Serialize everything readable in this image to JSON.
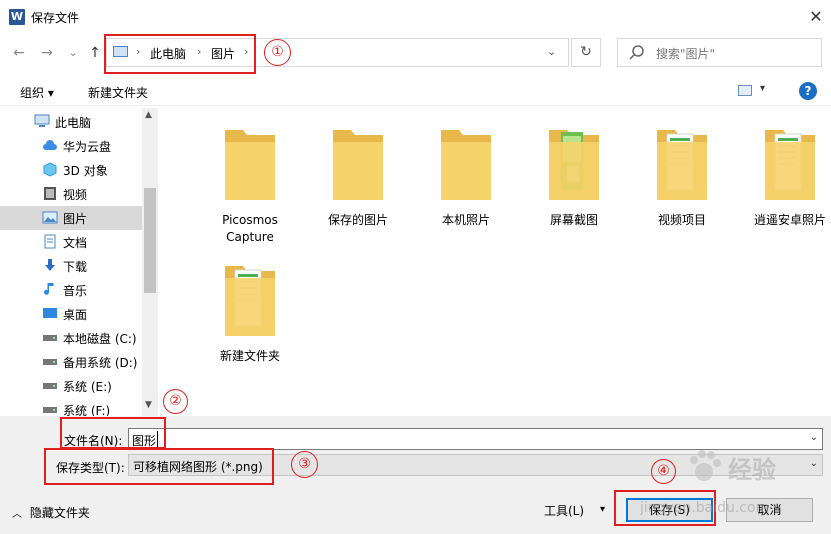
{
  "window": {
    "title": "保存文件",
    "app_icon": "W",
    "close": "✕"
  },
  "nav": {
    "back": "←",
    "forward": "→",
    "recent": "⌄",
    "up": "↑",
    "breadcrumbs": [
      "此电脑",
      "图片"
    ],
    "crumb_sep": "›",
    "search_placeholder": "搜索\"图片\""
  },
  "toolbar": {
    "organize": "组织 ▾",
    "new_folder": "新建文件夹",
    "view_drop": "▾",
    "help": "?"
  },
  "sidebar": {
    "items": [
      {
        "label": "此电脑",
        "icon": "computer-icon"
      },
      {
        "label": "华为云盘",
        "icon": "cloud-icon"
      },
      {
        "label": "3D 对象",
        "icon": "3d-objects-icon"
      },
      {
        "label": "视频",
        "icon": "video-icon"
      },
      {
        "label": "图片",
        "icon": "pictures-icon",
        "selected": true
      },
      {
        "label": "文档",
        "icon": "documents-icon"
      },
      {
        "label": "下载",
        "icon": "download-icon"
      },
      {
        "label": "音乐",
        "icon": "music-icon"
      },
      {
        "label": "桌面",
        "icon": "desktop-icon"
      },
      {
        "label": "本地磁盘 (C:)",
        "icon": "drive-icon"
      },
      {
        "label": "备用系统 (D:)",
        "icon": "drive-icon"
      },
      {
        "label": "系统 (E:)",
        "icon": "drive-icon"
      },
      {
        "label": "系统 (F:)",
        "icon": "drive-icon"
      }
    ]
  },
  "files": [
    {
      "label": "Picosmos\nCapture",
      "thumb": "folder"
    },
    {
      "label": "保存的图片",
      "thumb": "folder"
    },
    {
      "label": "本机照片",
      "thumb": "folder"
    },
    {
      "label": "屏幕截图",
      "thumb": "folder-photo"
    },
    {
      "label": "视频项目",
      "thumb": "folder-doc"
    },
    {
      "label": "逍遥安卓照片",
      "thumb": "folder-doc"
    },
    {
      "label": "新建文件夹",
      "thumb": "folder-doc"
    }
  ],
  "form": {
    "filename_label": "文件名(N):",
    "filename_value": "图形",
    "filetype_label": "保存类型(T):",
    "filetype_value": "可移植网络图形 (*.png)"
  },
  "footer": {
    "hide_folders": "隐藏文件夹",
    "tools": "工具(L)",
    "tools_drop": "▾",
    "save": "保存(S)",
    "cancel": "取消"
  },
  "annotations": [
    "①",
    "②",
    "③",
    "④"
  ],
  "watermark": {
    "brand": "经验",
    "site": "jingyan.baidu.com"
  },
  "colors": {
    "annotation_red": "#e02020",
    "folder_yellow": "#f6d36b",
    "accent_blue": "#0078d7"
  }
}
